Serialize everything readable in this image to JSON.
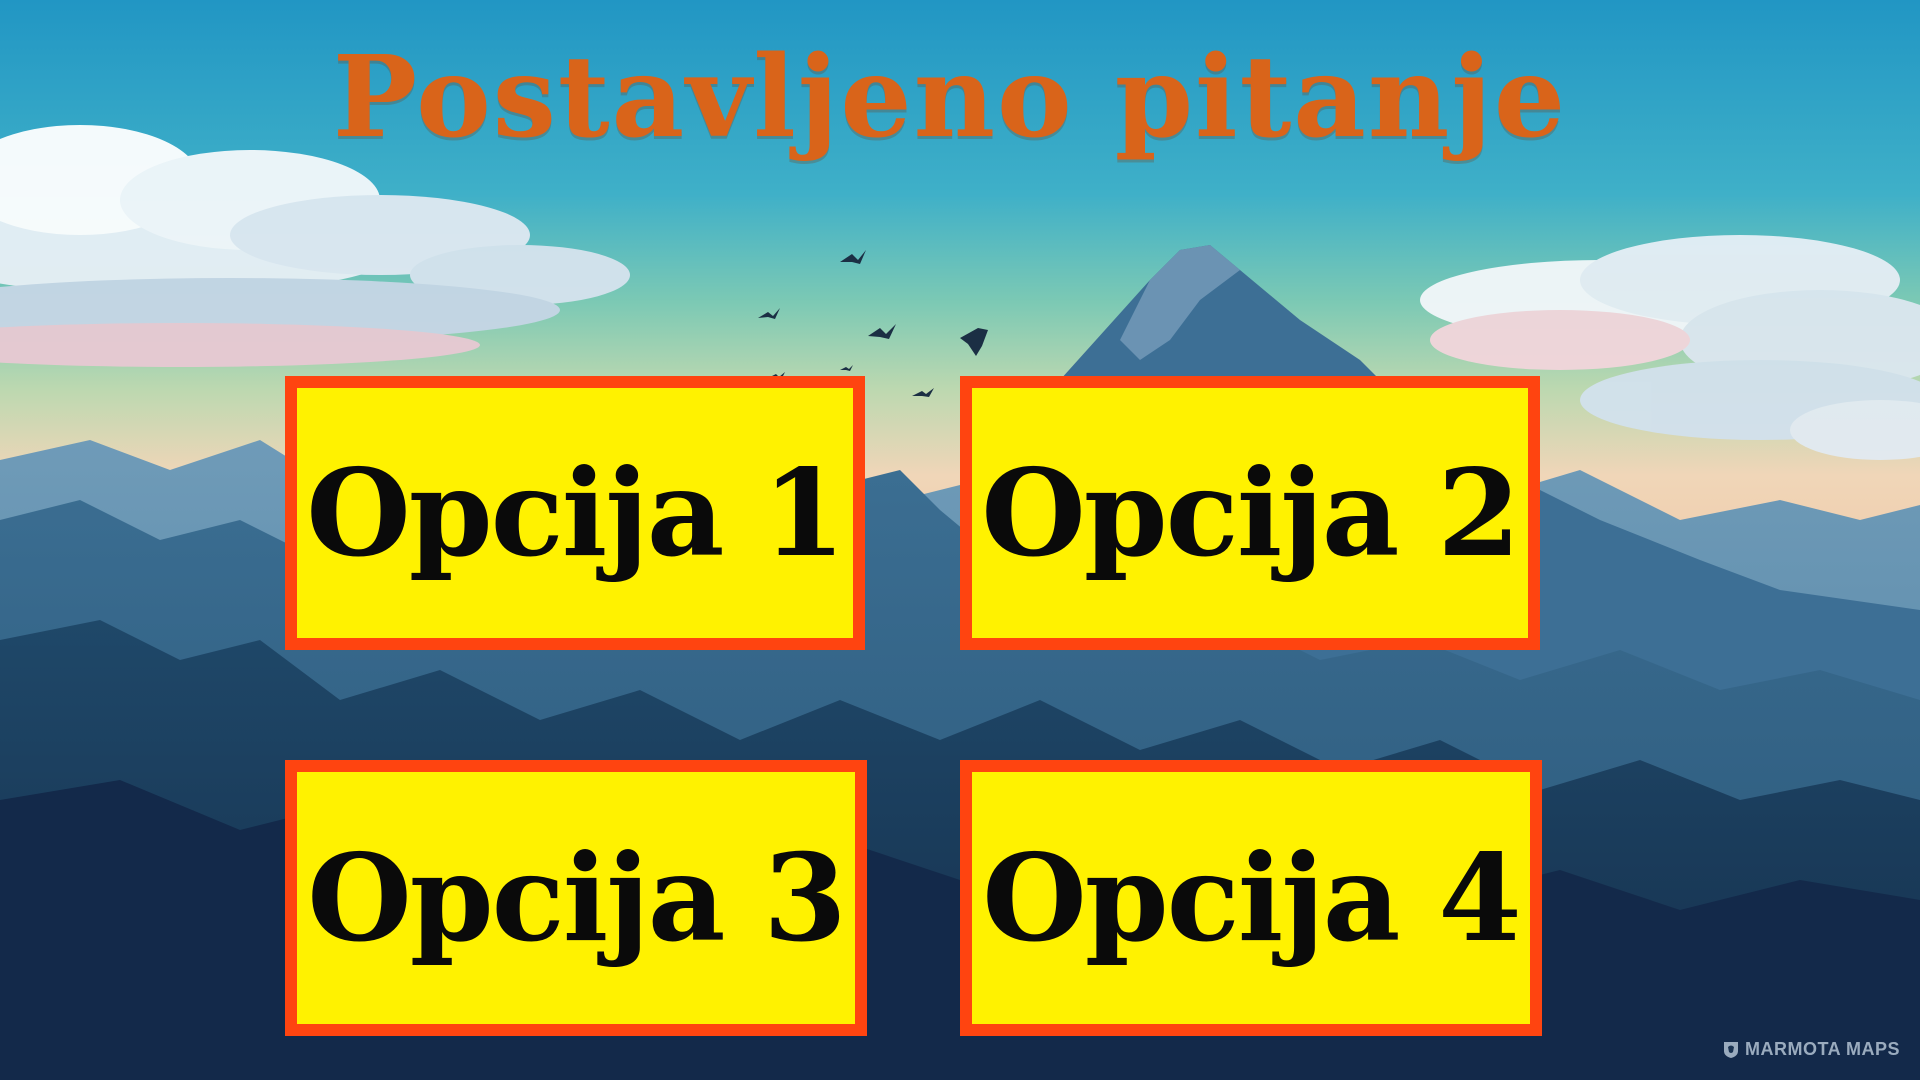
{
  "title": "Postavljeno pitanje",
  "options": [
    {
      "label": "Opcija 1"
    },
    {
      "label": "Opcija 2"
    },
    {
      "label": "Opcija 3"
    },
    {
      "label": "Opcija 4"
    }
  ],
  "watermark": "MARMOTA MAPS",
  "colors": {
    "title": "#d9641a",
    "option_fill": "#fff200",
    "option_border": "#ff4410",
    "option_text": "#0a0a0a"
  },
  "icons": {
    "watermark": "marmot-shield-icon"
  }
}
